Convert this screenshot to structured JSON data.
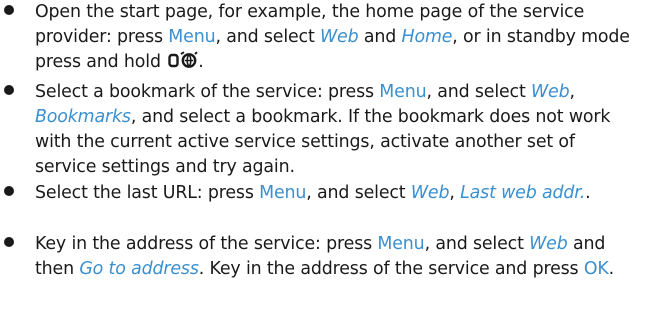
{
  "items": [
    {
      "lines": [
        [
          {
            "t": "Open the start page, for example, the home page of the service",
            "s": "n"
          }
        ],
        [
          {
            "t": "provider: press ",
            "s": "n"
          },
          {
            "t": "Menu",
            "s": "k"
          },
          {
            "t": ", and select ",
            "s": "n"
          },
          {
            "t": "Web",
            "s": "i"
          },
          {
            "t": " and ",
            "s": "n"
          },
          {
            "t": "Home",
            "s": "i"
          },
          {
            "t": ", or in standby mode",
            "s": "n"
          }
        ],
        [
          {
            "t": "press and hold ",
            "s": "n"
          },
          {
            "icon": "zero-web-key-icon"
          },
          {
            "t": ".",
            "s": "n"
          }
        ]
      ]
    },
    {
      "lines": [
        [
          {
            "t": "Select a bookmark of the service: press ",
            "s": "n"
          },
          {
            "t": "Menu",
            "s": "k"
          },
          {
            "t": ", and select ",
            "s": "n"
          },
          {
            "t": "Web",
            "s": "i"
          },
          {
            "t": ",",
            "s": "n"
          }
        ],
        [
          {
            "t": "Bookmarks",
            "s": "i"
          },
          {
            "t": ", and select a bookmark. If the bookmark does not work",
            "s": "n"
          }
        ],
        [
          {
            "t": "with the current active service settings, activate another set of",
            "s": "n"
          }
        ],
        [
          {
            "t": "service settings and try again.",
            "s": "n"
          }
        ]
      ]
    },
    {
      "lines": [
        [
          {
            "t": "Select the last URL: press ",
            "s": "n"
          },
          {
            "t": "Menu",
            "s": "k"
          },
          {
            "t": ", and select ",
            "s": "n"
          },
          {
            "t": "Web",
            "s": "i"
          },
          {
            "t": ", ",
            "s": "n"
          },
          {
            "t": "Last web addr.",
            "s": "i"
          },
          {
            "t": ".",
            "s": "n"
          }
        ]
      ]
    },
    {
      "lines": [
        [
          {
            "t": "Key in the address of the service: press ",
            "s": "n"
          },
          {
            "t": "Menu",
            "s": "k"
          },
          {
            "t": ", and select ",
            "s": "n"
          },
          {
            "t": "Web",
            "s": "i"
          },
          {
            "t": " and",
            "s": "n"
          }
        ],
        [
          {
            "t": "then ",
            "s": "n"
          },
          {
            "t": "Go to address",
            "s": "i"
          },
          {
            "t": ". Key in the address of the service and press ",
            "s": "n"
          },
          {
            "t": "OK",
            "s": "k"
          },
          {
            "t": ".",
            "s": "n"
          }
        ]
      ]
    }
  ]
}
